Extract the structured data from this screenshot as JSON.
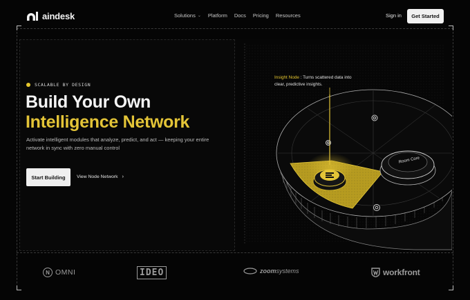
{
  "brand": {
    "name": "aindesk"
  },
  "nav": {
    "items": [
      {
        "label": "Solutions",
        "has_dropdown": true
      },
      {
        "label": "Platform"
      },
      {
        "label": "Docs"
      },
      {
        "label": "Pricing"
      },
      {
        "label": "Resources"
      }
    ],
    "signin": "Sign in",
    "get_started": "Get Started"
  },
  "hero": {
    "badge": "SCALABLE BY DESIGN",
    "title_line1": "Build Your Own",
    "title_line2": "Intelligence Network",
    "subtitle": "Activate intelligent modules that analyze, predict, and act — keeping your entire network in sync with zero manual control",
    "primary_cta": "Start Building",
    "secondary_cta": "View Node Network"
  },
  "visual": {
    "insight_key": "Insight Node",
    "insight_sep": " : ",
    "insight_text": "Turns scattered data into clear, predictive insights.",
    "hub_label": "Room Core"
  },
  "partners": {
    "omni": {
      "mark": "N",
      "name": "OMNI"
    },
    "ideo": "IDEO",
    "zoom": {
      "bold": "zoom",
      "rest": "systems"
    },
    "workfront": "workfront"
  },
  "colors": {
    "accent": "#e3c437",
    "background": "#050505",
    "text": "#f4f4f4",
    "muted": "#bdbdbd"
  },
  "icons": [
    "chevron-down-icon",
    "arrow-right-icon",
    "gear-icon",
    "insight-node-icon",
    "workfront-icon"
  ]
}
